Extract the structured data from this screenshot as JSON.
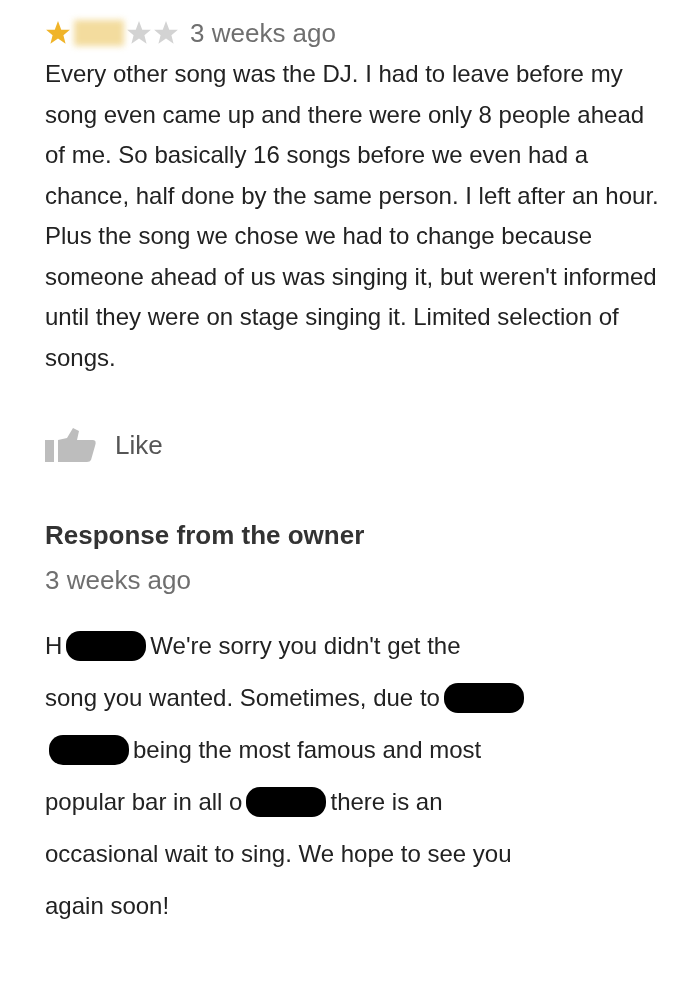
{
  "review": {
    "stars": 1,
    "time": "3 weeks ago",
    "text": "Every other song was the DJ. I had to leave before my song even came up and there were only 8 people ahead of me. So basically 16 songs before we even had a chance, half done by the same person. I left after an hour. Plus the song we chose we had to change because someone ahead of us was singing it, but weren't informed until they were on stage singing it. Limited selection of songs.",
    "like": "Like"
  },
  "response": {
    "title": "Response from the owner",
    "time": "3 weeks ago",
    "lines": [
      [
        {
          "kind": "text",
          "text": "H"
        },
        {
          "kind": "redaction"
        },
        {
          "kind": "text",
          "text": "We're sorry you didn't get the"
        }
      ],
      [
        {
          "kind": "text",
          "text": "song you wanted. Sometimes, due to"
        },
        {
          "kind": "redaction"
        }
      ],
      [
        {
          "kind": "redaction"
        },
        {
          "kind": "text",
          "text": "being the most famous and most"
        }
      ],
      [
        {
          "kind": "text",
          "text": "popular bar in all o"
        },
        {
          "kind": "redaction"
        },
        {
          "kind": "text",
          "text": "there is an"
        }
      ],
      [
        {
          "kind": "text",
          "text": "occasional wait to sing. We hope to see you"
        }
      ],
      [
        {
          "kind": "text",
          "text": "again soon!"
        }
      ]
    ]
  }
}
